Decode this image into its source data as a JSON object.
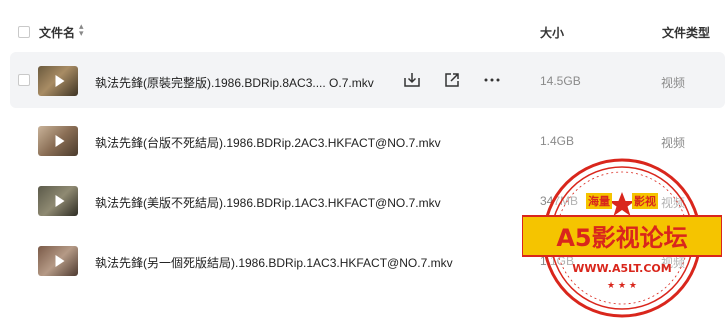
{
  "header": {
    "name_label": "文件名",
    "size_label": "大小",
    "type_label": "文件类型"
  },
  "rows": [
    {
      "name": "執法先鋒(原裝完整版).1986.BDRip.8AC3.... O.7.mkv",
      "size": "14.5GB",
      "type": "视频",
      "selected": true
    },
    {
      "name": "執法先鋒(台版不死結局).1986.BDRip.2AC3.HKFACT@NO.7.mkv",
      "size": "1.4GB",
      "type": "视频"
    },
    {
      "name": "執法先鋒(美版不死結局).1986.BDRip.1AC3.HKFACT@NO.7.mkv",
      "size": "347MB",
      "type": "视频"
    },
    {
      "name": "執法先鋒(另一個死版結局).1986.BDRip.1AC3.HKFACT@NO.7.mkv",
      "size": "1.1GB",
      "type": "视频"
    }
  ],
  "watermark": {
    "top_left": "海量",
    "top_right": "影视",
    "main": "A5影视论坛",
    "url": "WWW.A5LT.COM"
  },
  "colors": {
    "selected_row_bg": "#f3f4f6",
    "stamp_red": "#d9261c",
    "stamp_yellow": "#f5c400",
    "muted_text": "#8a8a8a"
  },
  "icons": [
    "checkbox",
    "sort-icon",
    "play-icon",
    "download-icon",
    "share-icon",
    "more-icon"
  ]
}
